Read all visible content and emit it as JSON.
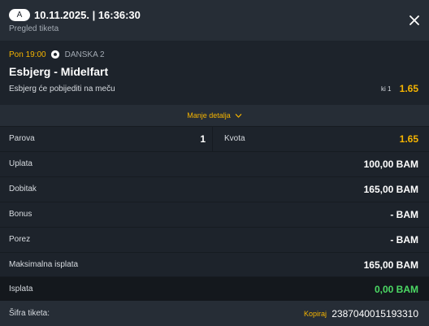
{
  "header": {
    "badge": "A",
    "ticket_time": "10.11.2025. | 16:36:30",
    "subtitle": "Pregled tiketa",
    "close_icon": "close-icon"
  },
  "match": {
    "time": "Pon 19:00",
    "sport_icon": "soccer-ball-icon",
    "league": "DANSKA 2",
    "teams": "Esbjerg - Midelfart",
    "pick": "Esbjerg će pobijediti na meču",
    "pick_code": "ki 1",
    "odd": "1.65"
  },
  "toggle": {
    "label": "Manje detalja",
    "icon": "chevron-down-icon"
  },
  "stats": {
    "pairs_label": "Parova",
    "pairs_value": "1",
    "odds_label": "Kvota",
    "odds_value": "1.65",
    "stake_label": "Uplata",
    "stake_value": "100,00 BAM",
    "win_label": "Dobitak",
    "win_value": "165,00 BAM",
    "bonus_label": "Bonus",
    "bonus_value": "- BAM",
    "tax_label": "Porez",
    "tax_value": "- BAM",
    "max_label": "Maksimalna isplata",
    "max_value": "165,00 BAM",
    "payout_label": "Isplata",
    "payout_value": "0,00 BAM"
  },
  "ticket_code": {
    "label": "Šifra tiketa:",
    "copy_label": "Kopiraj",
    "value": "2387040015193310"
  },
  "colors": {
    "accent": "#f5b400",
    "success": "#4cd964",
    "panel": "#1d232b",
    "background": "#262d36"
  }
}
